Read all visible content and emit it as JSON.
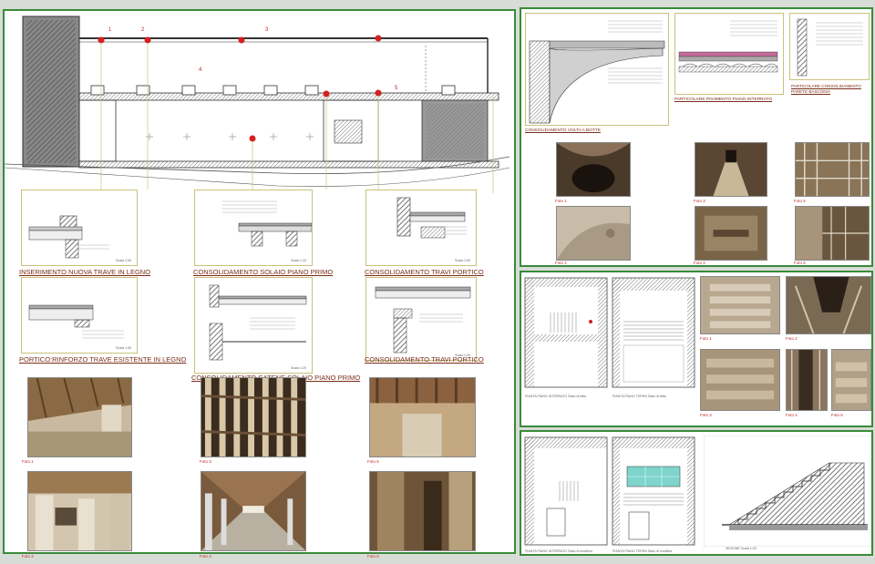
{
  "sheet1": {
    "plan_markers": [
      "1",
      "2",
      "3",
      "4",
      "5"
    ],
    "details": [
      {
        "title": "INSERIMENTO NUOVA TRAVE IN LEGNO",
        "scale": "Scala 1:50"
      },
      {
        "title": "CONSOLIDAMENTO  SOLAIO PIANO PRIMO",
        "scale": "Scala 1:10"
      },
      {
        "title": "CONSOLIDAMENTO TRAVI PORTICO",
        "scale": "Scala 1:50"
      },
      {
        "title": "PORTICO:RINFORZO TRAVE ESISTENTE IN LEGNO",
        "scale": "Scala 1:50"
      },
      {
        "title": "CONSOLIDAMENTO CATENE SOLAIO PIANO PRIMO",
        "scale": "Scala 1:20"
      },
      {
        "title": "CONSOLIDAMENTO TRAVI PORTICO",
        "scale": "Scala 1:20"
      }
    ],
    "photos": [
      "Foto 1",
      "Foto 2",
      "Foto 3",
      "Foto 4",
      "Foto 5",
      "Foto 6"
    ]
  },
  "sheet2": {
    "details": [
      {
        "title": "CONSOLIDAMENTO VOLTA A BOTTE"
      },
      {
        "title": "PARTICOLARE PAVIMENTO PIANO INTERRATO"
      },
      {
        "title": "PARTICOLARE CONSOLIDAMENTO PARETE BASCONIA"
      }
    ],
    "photos": [
      "Foto 1",
      "Foto 2",
      "Foto 3",
      "Foto 4",
      "Foto 5",
      "Foto 6"
    ]
  },
  "sheet3": {
    "plan_captions": [
      "PIANTA PIANO INTERRATO Stato di fatto",
      "PIANTA PIANO TERRA Stato di fatto"
    ],
    "photos": [
      "Foto 1",
      "Foto 2",
      "Foto 3",
      "Foto 4",
      "Foto 5"
    ]
  },
  "sheet4": {
    "plan_captions": [
      "PIANTA PIANO INTERRATO Stato di modifica",
      "PIANTA PIANO TERRA Stato di modifica",
      "SEZIONE Scala 1:20"
    ]
  },
  "colors": {
    "frame": "#3a8a3a",
    "title": "#7a2e1a",
    "marker": "#d42020",
    "wall": "#666666",
    "detail_border": "#c9c27a"
  }
}
